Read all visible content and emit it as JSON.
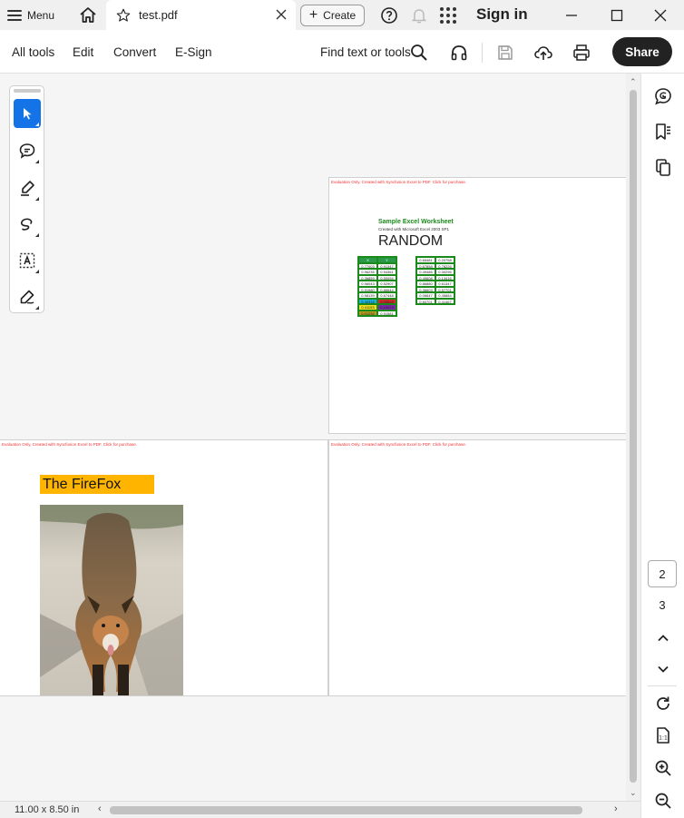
{
  "titlebar": {
    "menu_label": "Menu",
    "tab_title": "test.pdf",
    "create_label": "Create",
    "signin_label": "Sign in"
  },
  "toolbar": {
    "nav": [
      "All tools",
      "Edit",
      "Convert",
      "E-Sign"
    ],
    "find_label": "Find text or tools",
    "share_label": "Share"
  },
  "document": {
    "eval_note": "Evaluation Only. Created with Syncfusion Excel to PDF. Click for purchase.",
    "worksheet_title": "Sample Excel Worksheet",
    "worksheet_subtitle": "Created with Microsoft Excel 2003 SP1",
    "random_label": "RANDOM",
    "table1_headers": [
      "X",
      "Y"
    ],
    "table1_rows": [
      [
        "0.77003",
        "0.91347"
      ],
      [
        "0.96235",
        "0.54361"
      ],
      [
        "0.36859",
        "0.50094"
      ],
      [
        "0.96043",
        "0.52907"
      ],
      [
        "0.91980",
        "0.86644"
      ],
      [
        "0.58139",
        "0.67448"
      ],
      [
        "0.40318",
        "0.00618"
      ],
      [
        "0.41153",
        "0.15473"
      ],
      [
        "0.01234",
        "0.91581"
      ]
    ],
    "table2_rows": [
      [
        "0.65481",
        "0.20758"
      ],
      [
        "0.67858",
        "0.76226"
      ],
      [
        "0.49486",
        "0.30296"
      ],
      [
        "0.49608",
        "0.13416"
      ],
      [
        "0.86880",
        "0.61347"
      ],
      [
        "0.36603",
        "0.57701"
      ],
      [
        "0.06647",
        "0.45884"
      ],
      [
        "0.60701",
        "0.41467"
      ]
    ],
    "firefox_title": "The FireFox"
  },
  "pages": {
    "current": "2",
    "next": "3"
  },
  "status": {
    "page_size": "11.00 x 8.50 in"
  },
  "colors": {
    "accent": "#1473e6",
    "share_bg": "#222222",
    "highlight": "#ffb400",
    "sheet_green": "#1a8a1a"
  }
}
